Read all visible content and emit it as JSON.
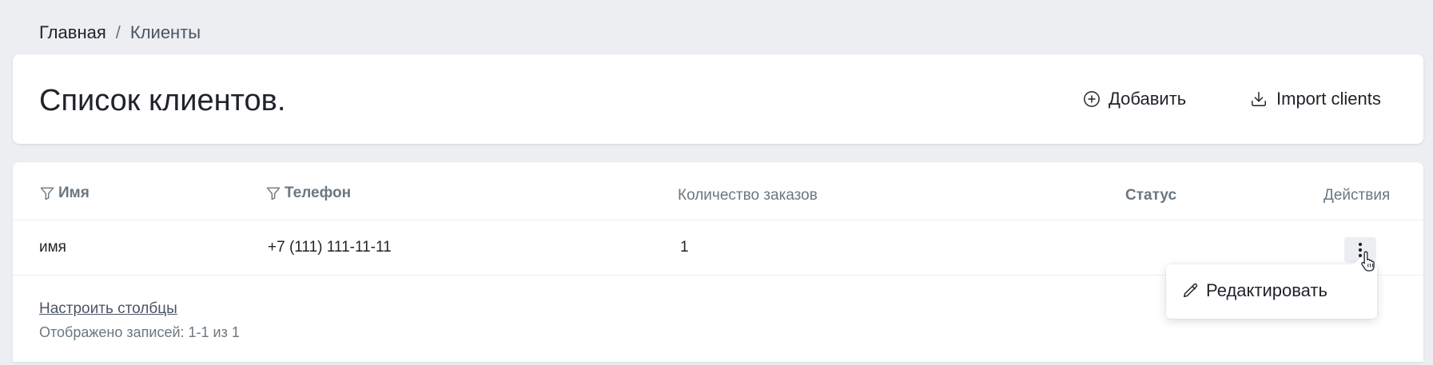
{
  "breadcrumb": {
    "home": "Главная",
    "separator": "/",
    "current": "Клиенты"
  },
  "header": {
    "title": "Список клиентов.",
    "add_label": "Добавить",
    "import_label": "Import clients"
  },
  "table": {
    "columns": {
      "name": "Имя",
      "phone": "Телефон",
      "orders": "Количество заказов",
      "status": "Статус",
      "actions": "Действия"
    },
    "rows": [
      {
        "name": "имя",
        "phone": "+7 (111) 111-11-11",
        "orders": "1",
        "status": ""
      }
    ]
  },
  "row_menu": {
    "edit_label": "Редактировать"
  },
  "footer": {
    "configure_columns": "Настроить столбцы",
    "records_info": "Отображено записей: 1-1 из 1"
  },
  "icons": {
    "add": "plus-circle-icon",
    "import": "download-icon",
    "filter": "filter-icon",
    "kebab": "more-vertical-icon",
    "edit": "pencil-icon",
    "cursor": "hand-pointer-icon"
  },
  "colors": {
    "background": "#eceef1",
    "card": "#ffffff",
    "text": "#1f2329",
    "muted": "#6b7780"
  }
}
